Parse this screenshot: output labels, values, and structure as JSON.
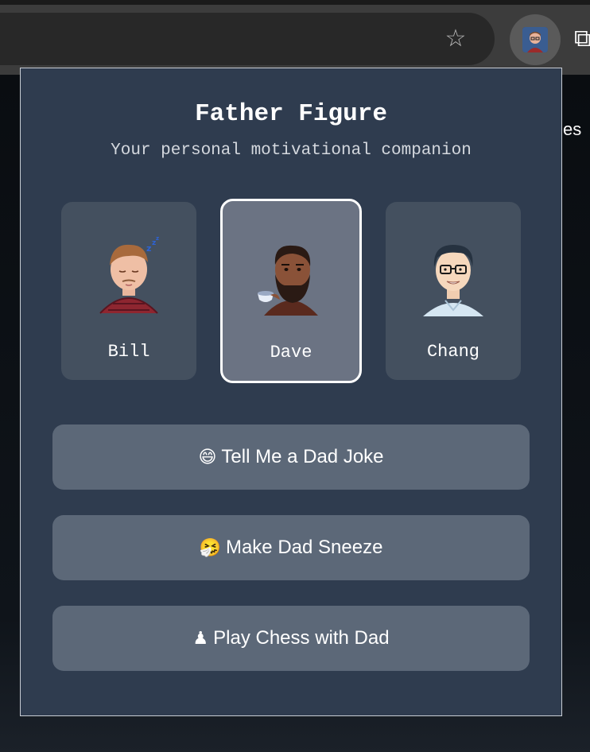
{
  "browser": {
    "page_text": "es"
  },
  "popup": {
    "title": "Father Figure",
    "subtitle": "Your personal motivational companion",
    "dads": [
      {
        "name": "Bill",
        "selected": false
      },
      {
        "name": "Dave",
        "selected": true
      },
      {
        "name": "Chang",
        "selected": false
      }
    ],
    "actions": [
      {
        "emoji": "😄",
        "label": "Tell Me a Dad Joke"
      },
      {
        "emoji": "🤧",
        "label": "Make Dad Sneeze"
      },
      {
        "emoji": "♟",
        "label": "Play Chess with Dad"
      }
    ]
  },
  "icons": {
    "bookmark": "star-icon",
    "extension": "father-figure-extension-icon",
    "extensions_menu": "puzzle-icon"
  },
  "colors": {
    "popup_bg": "#2f3c4f",
    "card_bg": "#44505f",
    "card_selected_bg": "#6b7383",
    "button_bg": "#5c6878"
  }
}
